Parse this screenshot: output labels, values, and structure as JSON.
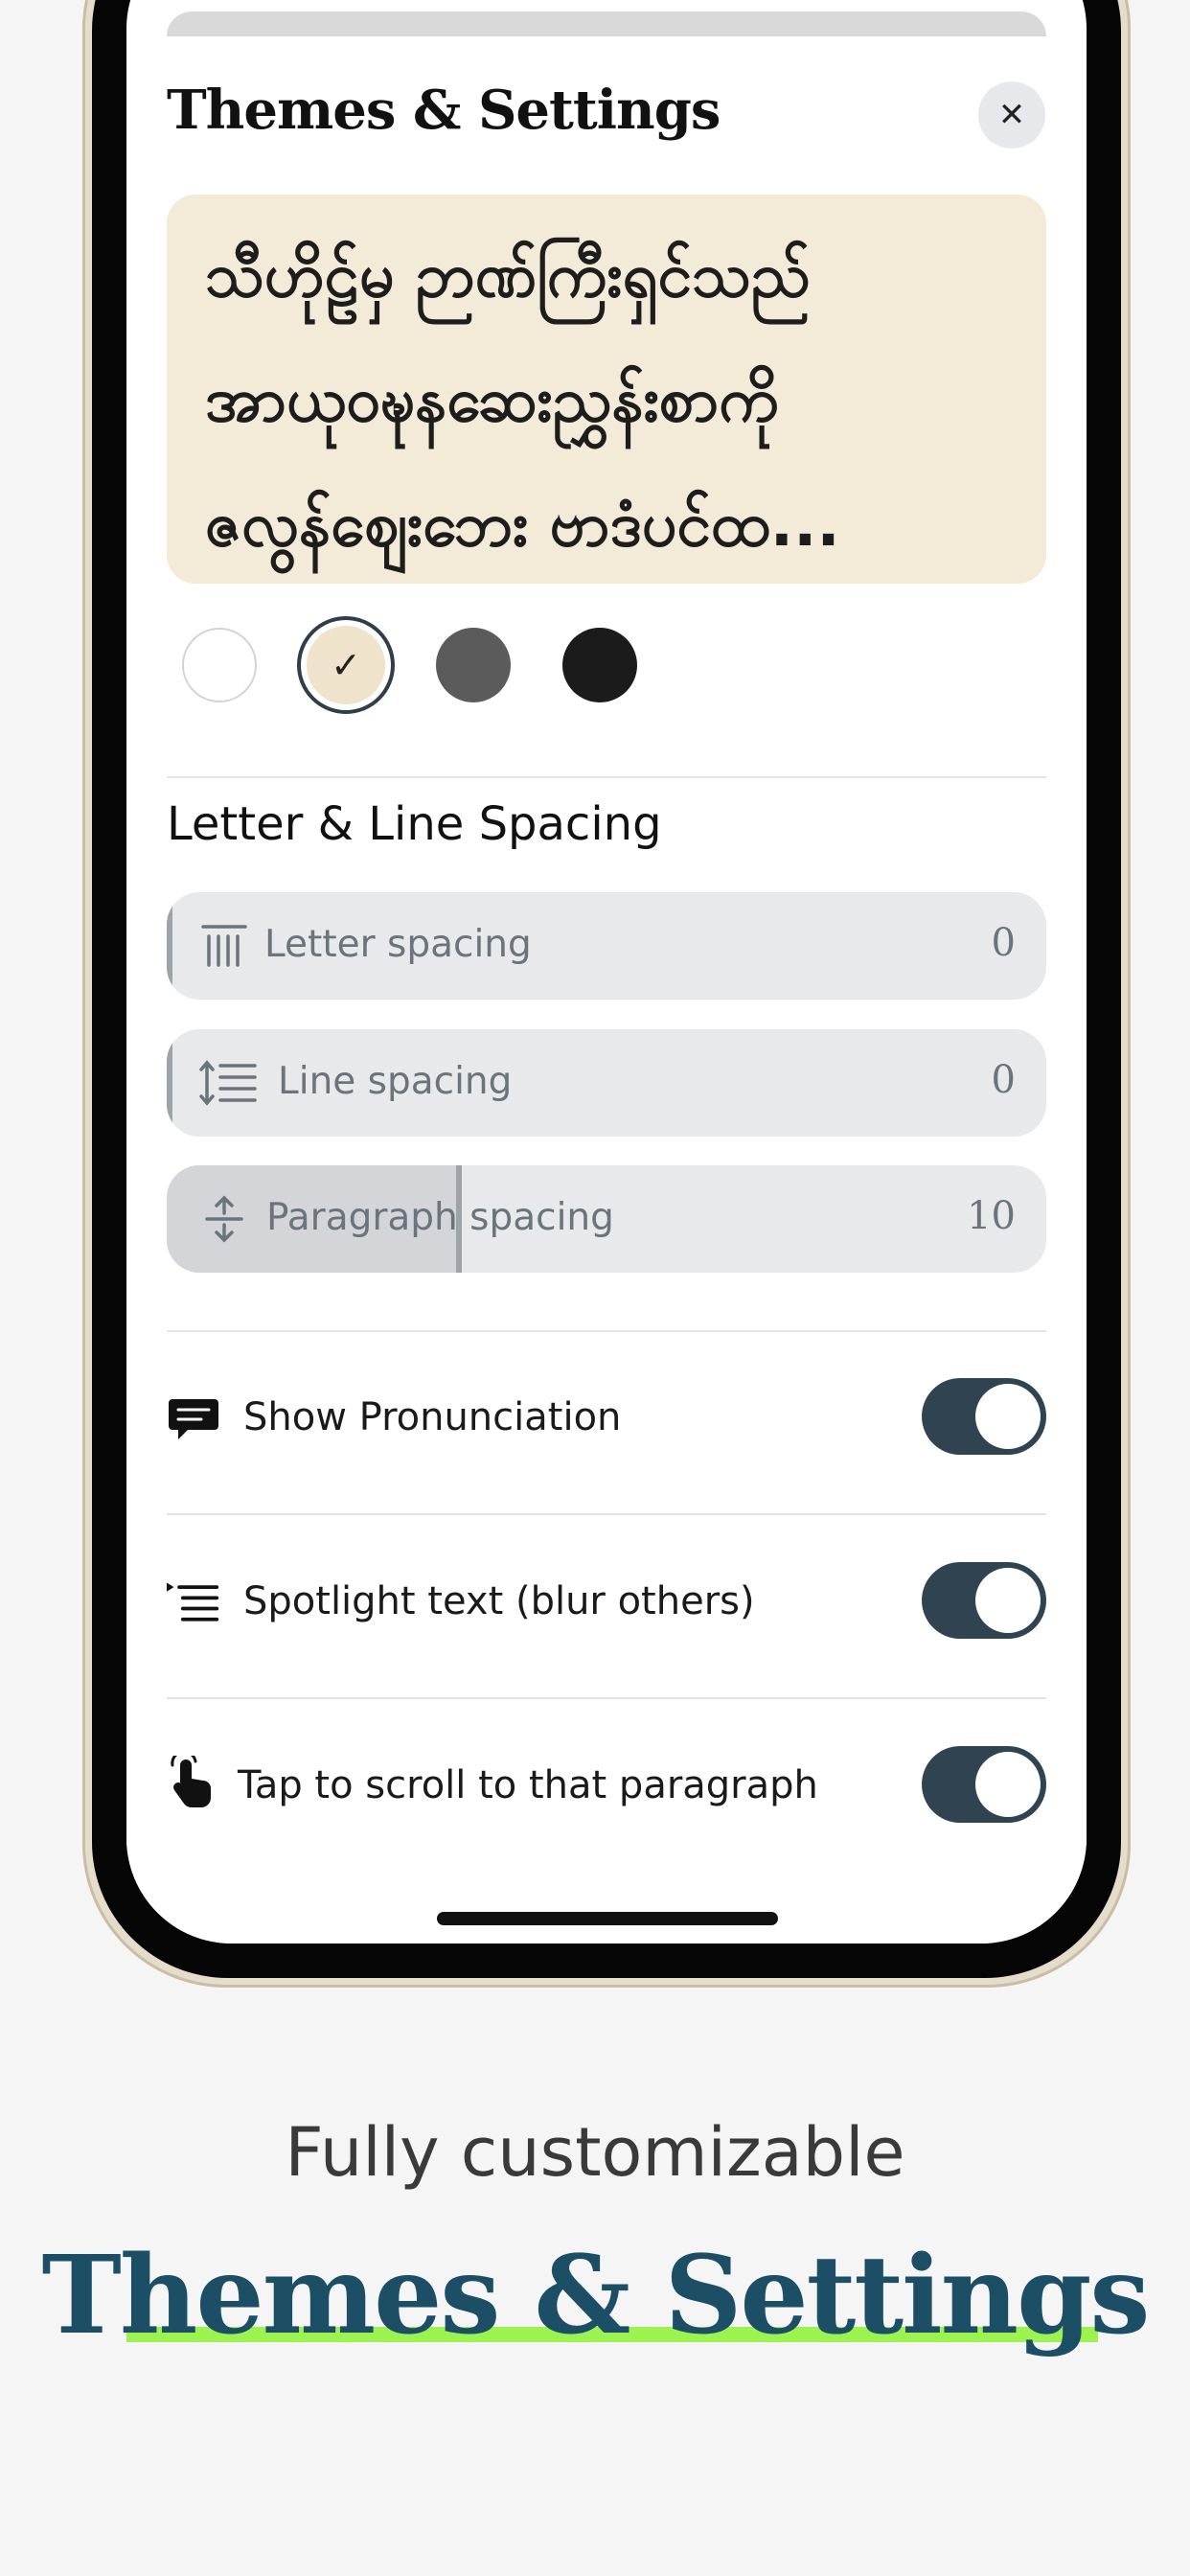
{
  "sheet": {
    "title": "Themes & Settings",
    "close_icon": "close-icon"
  },
  "preview": {
    "lines": [
      "သီဟိုဠ်မှ ဉာဏ်ကြီးရှင်သည်",
      "အာယုဝဍ္ဎနဆေးညွှန်းစာကို",
      "ဇလွန်ဈေးဘေး ဗာဒံပင်ထ..."
    ]
  },
  "themes": {
    "swatches": [
      "white",
      "sepia",
      "gray",
      "black"
    ],
    "selected": "sepia",
    "check_mark": "✓",
    "colors": {
      "white": "#ffffff",
      "sepia": "#efe3cc",
      "gray": "#5b5b5b",
      "black": "#1b1b1b"
    }
  },
  "spacing": {
    "title": "Letter & Line Spacing",
    "letter": {
      "label": "Letter spacing",
      "value": "0",
      "icon": "letter-spacing-icon"
    },
    "line": {
      "label": "Line spacing",
      "value": "0",
      "icon": "line-spacing-icon"
    },
    "paragraph": {
      "label": "Paragraph spacing",
      "value": "10",
      "icon": "paragraph-spacing-icon"
    }
  },
  "toggles": {
    "pronunciation": {
      "label": "Show Pronunciation",
      "on": true,
      "icon": "speech-bubble-icon"
    },
    "spotlight": {
      "label": "Spotlight text (blur others)",
      "on": true,
      "icon": "spotlight-list-icon"
    },
    "tap_scroll": {
      "label": "Tap to scroll to that paragraph",
      "on": true,
      "icon": "tap-hand-icon"
    }
  },
  "marketing": {
    "tagline": "Fully customizable",
    "headline": "Themes & Settings"
  },
  "colors": {
    "toggle_on": "#2f4450",
    "headline": "#1c4e66",
    "highlight": "#9cf24f",
    "preview_bg": "#f3ead7"
  }
}
